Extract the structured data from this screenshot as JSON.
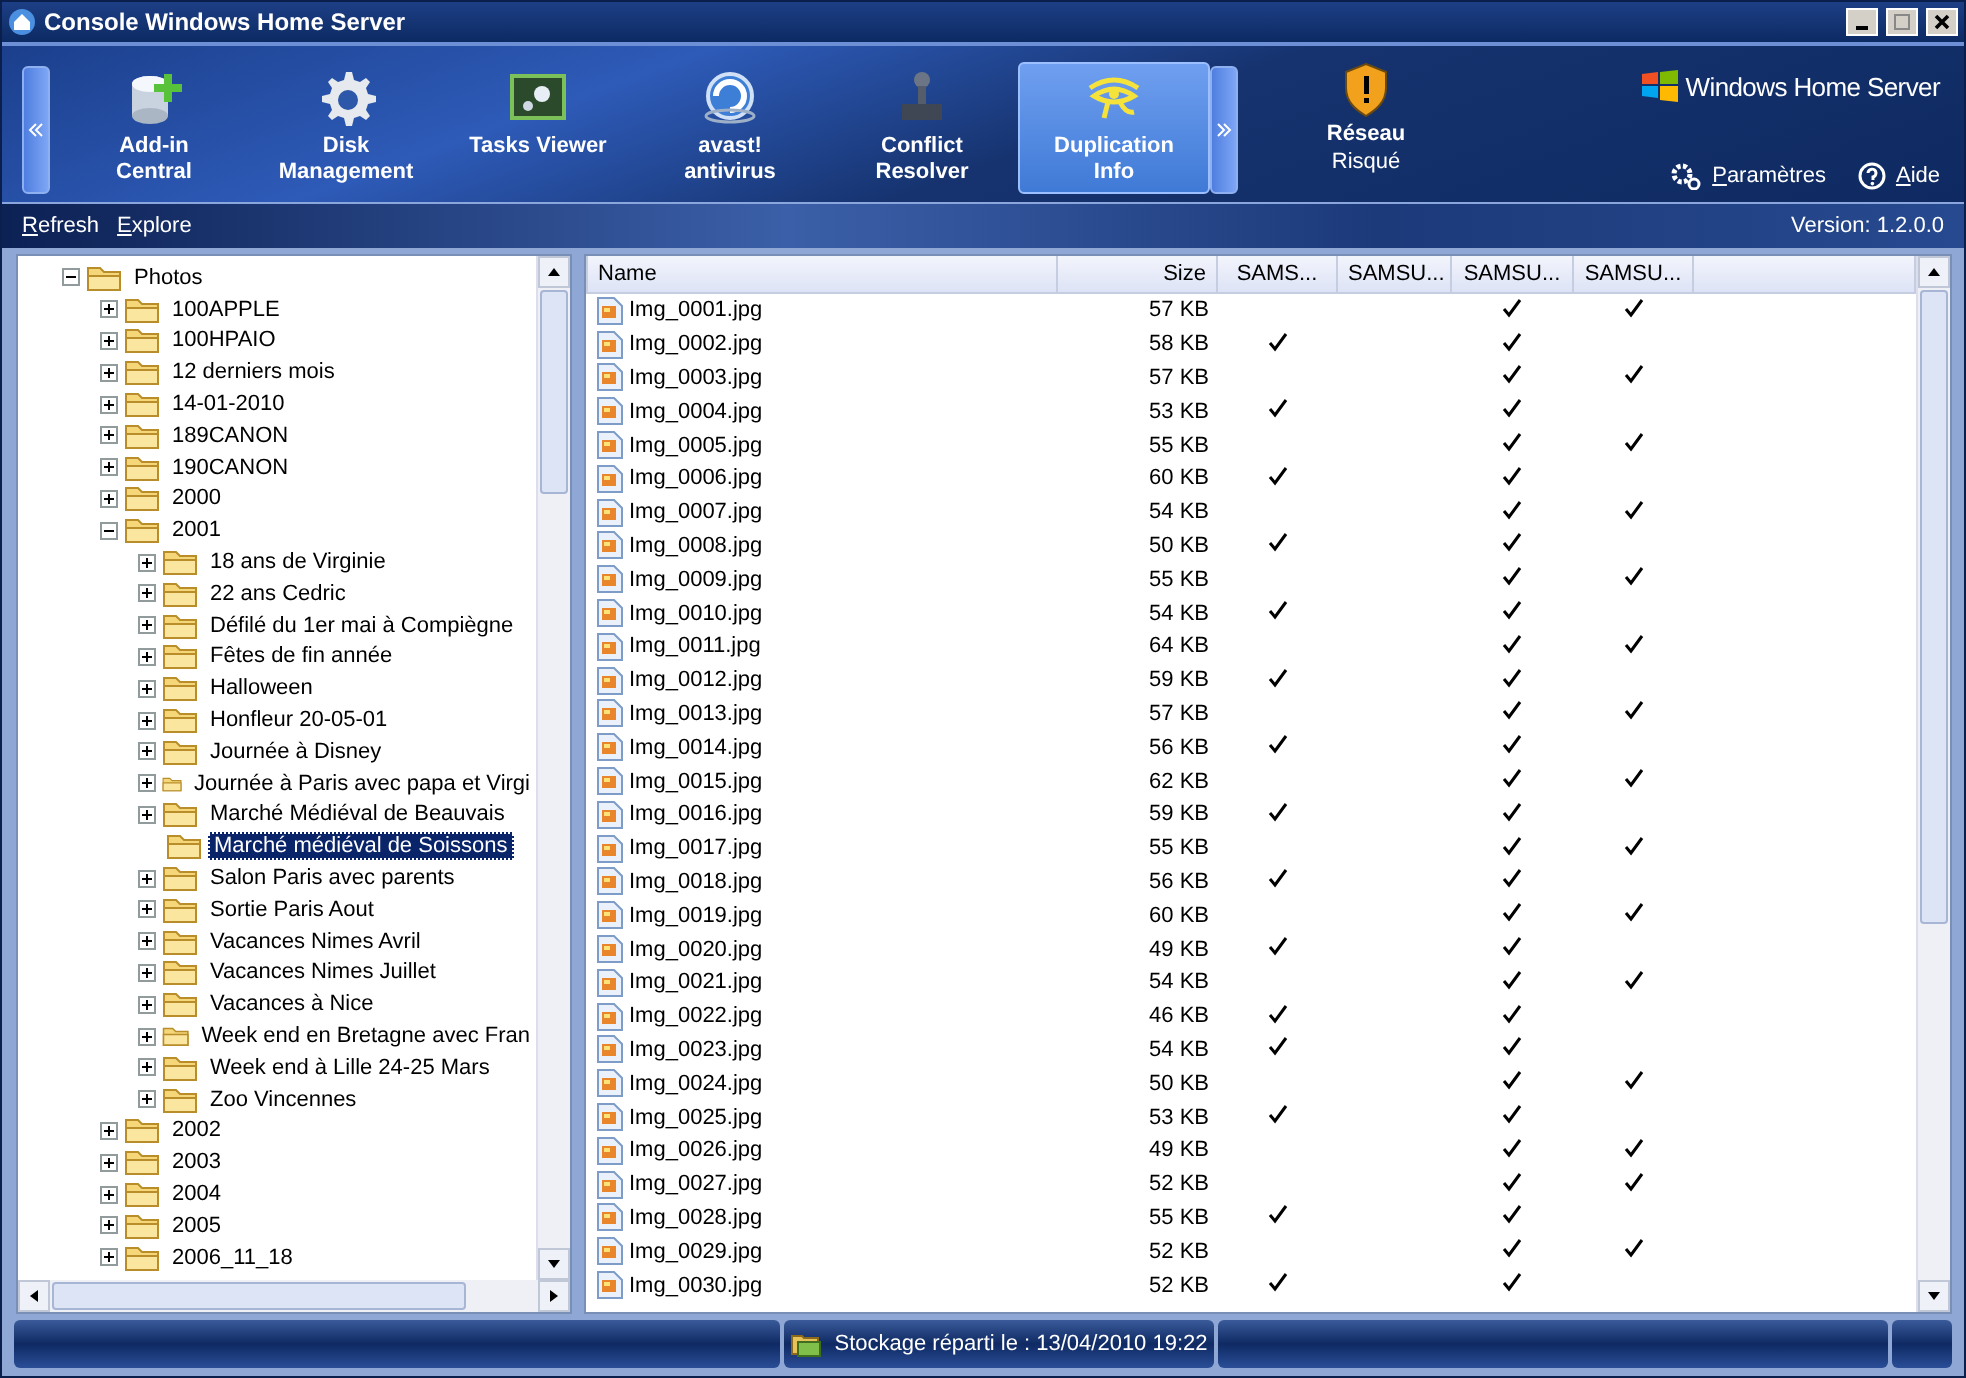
{
  "window": {
    "title": "Console Windows Home Server"
  },
  "nav": {
    "tabs": [
      {
        "label": "Add-in\nCentral",
        "selected": false
      },
      {
        "label": "Disk\nManagement",
        "selected": false
      },
      {
        "label": "Tasks Viewer",
        "selected": false
      },
      {
        "label": "avast!\nantivirus",
        "selected": false
      },
      {
        "label": "Conflict\nResolver",
        "selected": false
      },
      {
        "label": "Duplication\nInfo",
        "selected": true
      }
    ],
    "network": {
      "label": "Réseau",
      "status": "Risqué"
    },
    "brand": "Windows Home Server",
    "links": [
      "Paramètres",
      "Aide"
    ]
  },
  "toolbar": {
    "actions": [
      "Refresh",
      "Explore"
    ],
    "version": "Version: 1.2.0.0"
  },
  "tree": [
    {
      "label": "Photos",
      "expandable": true,
      "expanded": true,
      "selected": false,
      "children": [
        {
          "label": "100APPLE",
          "expandable": true,
          "expanded": false,
          "selected": false
        },
        {
          "label": "100HPAIO",
          "expandable": true,
          "expanded": false,
          "selected": false
        },
        {
          "label": "12 derniers mois",
          "expandable": true,
          "expanded": false,
          "selected": false
        },
        {
          "label": "14-01-2010",
          "expandable": true,
          "expanded": false,
          "selected": false
        },
        {
          "label": "189CANON",
          "expandable": true,
          "expanded": false,
          "selected": false
        },
        {
          "label": "190CANON",
          "expandable": true,
          "expanded": false,
          "selected": false
        },
        {
          "label": "2000",
          "expandable": true,
          "expanded": false,
          "selected": false
        },
        {
          "label": "2001",
          "expandable": true,
          "expanded": true,
          "selected": false,
          "children": [
            {
              "label": "18 ans de Virginie",
              "expandable": true,
              "expanded": false,
              "selected": false
            },
            {
              "label": "22 ans Cedric",
              "expandable": true,
              "expanded": false,
              "selected": false
            },
            {
              "label": "Défilé du 1er mai à Compiègne",
              "expandable": true,
              "expanded": false,
              "selected": false
            },
            {
              "label": "Fêtes de fin année",
              "expandable": true,
              "expanded": false,
              "selected": false
            },
            {
              "label": "Halloween",
              "expandable": true,
              "expanded": false,
              "selected": false
            },
            {
              "label": "Honfleur 20-05-01",
              "expandable": true,
              "expanded": false,
              "selected": false
            },
            {
              "label": "Journée à Disney",
              "expandable": true,
              "expanded": false,
              "selected": false
            },
            {
              "label": "Journée à Paris avec papa et Virgi",
              "expandable": true,
              "expanded": false,
              "selected": false
            },
            {
              "label": "Marché Médiéval de Beauvais",
              "expandable": true,
              "expanded": false,
              "selected": false
            },
            {
              "label": "Marché médiéval de Soissons",
              "expandable": false,
              "expanded": false,
              "selected": true
            },
            {
              "label": "Salon Paris avec parents",
              "expandable": true,
              "expanded": false,
              "selected": false
            },
            {
              "label": "Sortie Paris Aout",
              "expandable": true,
              "expanded": false,
              "selected": false
            },
            {
              "label": "Vacances Nimes Avril",
              "expandable": true,
              "expanded": false,
              "selected": false
            },
            {
              "label": "Vacances Nimes Juillet",
              "expandable": true,
              "expanded": false,
              "selected": false
            },
            {
              "label": "Vacances à Nice",
              "expandable": true,
              "expanded": false,
              "selected": false
            },
            {
              "label": "Week end en Bretagne avec Fran",
              "expandable": true,
              "expanded": false,
              "selected": false
            },
            {
              "label": "Week end à Lille 24-25 Mars",
              "expandable": true,
              "expanded": false,
              "selected": false
            },
            {
              "label": "Zoo Vincennes",
              "expandable": true,
              "expanded": false,
              "selected": false
            }
          ]
        },
        {
          "label": "2002",
          "expandable": true,
          "expanded": false,
          "selected": false
        },
        {
          "label": "2003",
          "expandable": true,
          "expanded": false,
          "selected": false
        },
        {
          "label": "2004",
          "expandable": true,
          "expanded": false,
          "selected": false
        },
        {
          "label": "2005",
          "expandable": true,
          "expanded": false,
          "selected": false
        },
        {
          "label": "2006_11_18",
          "expandable": true,
          "expanded": false,
          "selected": false
        }
      ]
    }
  ],
  "table": {
    "columns": [
      "Name",
      "Size",
      "SAMS...",
      "SAMSU...",
      "SAMSU...",
      "SAMSU..."
    ],
    "rows": [
      {
        "name": "Img_0001.jpg",
        "size": "57 KB",
        "checks": [
          false,
          false,
          true,
          true
        ]
      },
      {
        "name": "Img_0002.jpg",
        "size": "58 KB",
        "checks": [
          true,
          false,
          true,
          false
        ]
      },
      {
        "name": "Img_0003.jpg",
        "size": "57 KB",
        "checks": [
          false,
          false,
          true,
          true
        ]
      },
      {
        "name": "Img_0004.jpg",
        "size": "53 KB",
        "checks": [
          true,
          false,
          true,
          false
        ]
      },
      {
        "name": "Img_0005.jpg",
        "size": "55 KB",
        "checks": [
          false,
          false,
          true,
          true
        ]
      },
      {
        "name": "Img_0006.jpg",
        "size": "60 KB",
        "checks": [
          true,
          false,
          true,
          false
        ]
      },
      {
        "name": "Img_0007.jpg",
        "size": "54 KB",
        "checks": [
          false,
          false,
          true,
          true
        ]
      },
      {
        "name": "Img_0008.jpg",
        "size": "50 KB",
        "checks": [
          true,
          false,
          true,
          false
        ]
      },
      {
        "name": "Img_0009.jpg",
        "size": "55 KB",
        "checks": [
          false,
          false,
          true,
          true
        ]
      },
      {
        "name": "Img_0010.jpg",
        "size": "54 KB",
        "checks": [
          true,
          false,
          true,
          false
        ]
      },
      {
        "name": "Img_0011.jpg",
        "size": "64 KB",
        "checks": [
          false,
          false,
          true,
          true
        ]
      },
      {
        "name": "Img_0012.jpg",
        "size": "59 KB",
        "checks": [
          true,
          false,
          true,
          false
        ]
      },
      {
        "name": "Img_0013.jpg",
        "size": "57 KB",
        "checks": [
          false,
          false,
          true,
          true
        ]
      },
      {
        "name": "Img_0014.jpg",
        "size": "56 KB",
        "checks": [
          true,
          false,
          true,
          false
        ]
      },
      {
        "name": "Img_0015.jpg",
        "size": "62 KB",
        "checks": [
          false,
          false,
          true,
          true
        ]
      },
      {
        "name": "Img_0016.jpg",
        "size": "59 KB",
        "checks": [
          true,
          false,
          true,
          false
        ]
      },
      {
        "name": "Img_0017.jpg",
        "size": "55 KB",
        "checks": [
          false,
          false,
          true,
          true
        ]
      },
      {
        "name": "Img_0018.jpg",
        "size": "56 KB",
        "checks": [
          true,
          false,
          true,
          false
        ]
      },
      {
        "name": "Img_0019.jpg",
        "size": "60 KB",
        "checks": [
          false,
          false,
          true,
          true
        ]
      },
      {
        "name": "Img_0020.jpg",
        "size": "49 KB",
        "checks": [
          true,
          false,
          true,
          false
        ]
      },
      {
        "name": "Img_0021.jpg",
        "size": "54 KB",
        "checks": [
          false,
          false,
          true,
          true
        ]
      },
      {
        "name": "Img_0022.jpg",
        "size": "46 KB",
        "checks": [
          true,
          false,
          true,
          false
        ]
      },
      {
        "name": "Img_0023.jpg",
        "size": "54 KB",
        "checks": [
          true,
          false,
          true,
          false
        ]
      },
      {
        "name": "Img_0024.jpg",
        "size": "50 KB",
        "checks": [
          false,
          false,
          true,
          true
        ]
      },
      {
        "name": "Img_0025.jpg",
        "size": "53 KB",
        "checks": [
          true,
          false,
          true,
          false
        ]
      },
      {
        "name": "Img_0026.jpg",
        "size": "49 KB",
        "checks": [
          false,
          false,
          true,
          true
        ]
      },
      {
        "name": "Img_0027.jpg",
        "size": "52 KB",
        "checks": [
          false,
          false,
          true,
          true
        ]
      },
      {
        "name": "Img_0028.jpg",
        "size": "55 KB",
        "checks": [
          true,
          false,
          true,
          false
        ]
      },
      {
        "name": "Img_0029.jpg",
        "size": "52 KB",
        "checks": [
          false,
          false,
          true,
          true
        ]
      },
      {
        "name": "Img_0030.jpg",
        "size": "52 KB",
        "checks": [
          true,
          false,
          true,
          false
        ]
      }
    ]
  },
  "status_bar": {
    "text": "Stockage réparti le : 13/04/2010 19:22"
  }
}
